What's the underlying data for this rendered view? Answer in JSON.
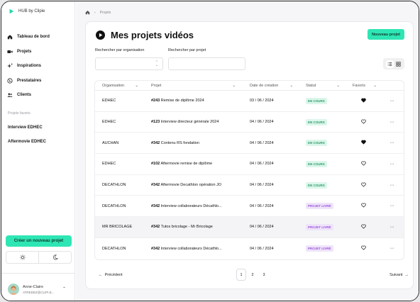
{
  "app": {
    "brand": "HUB by Clipie"
  },
  "sidebar": {
    "items": [
      {
        "label": "Tableau de bord",
        "icon": "home-icon"
      },
      {
        "label": "Projets",
        "icon": "video-icon"
      },
      {
        "label": "Inspirations",
        "icon": "sparkles-icon"
      },
      {
        "label": "Prestataires",
        "icon": "globe-icon"
      },
      {
        "label": "Clients",
        "icon": "users-icon"
      }
    ],
    "favorites_title": "Projets favoris",
    "favorites": [
      "Interview EDHEC",
      "Aftermovie EDHEC"
    ],
    "new_project_label": "Créer un nouveau projet",
    "user": {
      "name": "Anne-Claire",
      "email": "ATREDEZ@CLIPI.E..."
    }
  },
  "breadcrumb": {
    "current": "Projets"
  },
  "main": {
    "title": "Mes projets vidéos",
    "new_button": "Nouveau projet",
    "filters": {
      "org_label": "Rechercher par organisation",
      "org_value": "",
      "project_label": "Rechercher par projet",
      "project_value": ""
    },
    "table": {
      "headers": {
        "org": "Organisation",
        "project": "Projet",
        "date": "Date de création",
        "status": "Statut",
        "fav": "Favoris"
      },
      "rows": [
        {
          "org": "EDHEC",
          "num": "#243",
          "title": "Remise de diplôme 2024",
          "date": "03 / 06 / 2024",
          "status": "EN COURS",
          "status_type": "green",
          "fav": true
        },
        {
          "org": "EDHEC",
          "num": "#123",
          "title": "Interview directeur générale 2024",
          "date": "04 / 06 / 2024",
          "status": "EN COURS",
          "status_type": "green",
          "fav": false
        },
        {
          "org": "AUCHAN",
          "num": "#342",
          "title": "Contenu RS fondation",
          "date": "04 / 06 / 2024",
          "status": "EN COURS",
          "status_type": "green",
          "fav": true
        },
        {
          "org": "EDHEC",
          "num": "#102",
          "title": "Aftermovie remise de diplôme",
          "date": "04 / 06 / 2024",
          "status": "EN COURS",
          "status_type": "green",
          "fav": false
        },
        {
          "org": "DECATHLON",
          "num": "#342",
          "title": "Aftermovie Decathlon opération JO",
          "date": "04 / 06 / 2024",
          "status": "EN COURS",
          "status_type": "green",
          "fav": false
        },
        {
          "org": "DECATHLON",
          "num": "#342",
          "title": "Interview collaborateurs Décathlo...",
          "date": "04 / 06 / 2024",
          "status": "PROJET LIVRÉ",
          "status_type": "purple",
          "fav": false
        },
        {
          "org": "MR BRICOLAGE",
          "num": "#342",
          "title": "Tutos bricolage - Mr Bricolage",
          "date": "04 / 06 / 2024",
          "status": "PROJET LIVRÉ",
          "status_type": "purple",
          "fav": false
        },
        {
          "org": "DECATHLON",
          "num": "#342",
          "title": "Interview collaborateurs Décathlo...",
          "date": "04 / 06 / 2024",
          "status": "PROJET LIVRÉ",
          "status_type": "purple",
          "fav": false
        }
      ]
    },
    "pagination": {
      "prev": "Précédent",
      "next": "Suivant",
      "pages": [
        "1",
        "2",
        "3"
      ],
      "current": "1"
    }
  },
  "colors": {
    "accent": "#2ee6b4",
    "status_green_bg": "#dbf6ea",
    "status_purple_bg": "#efe4fb"
  }
}
